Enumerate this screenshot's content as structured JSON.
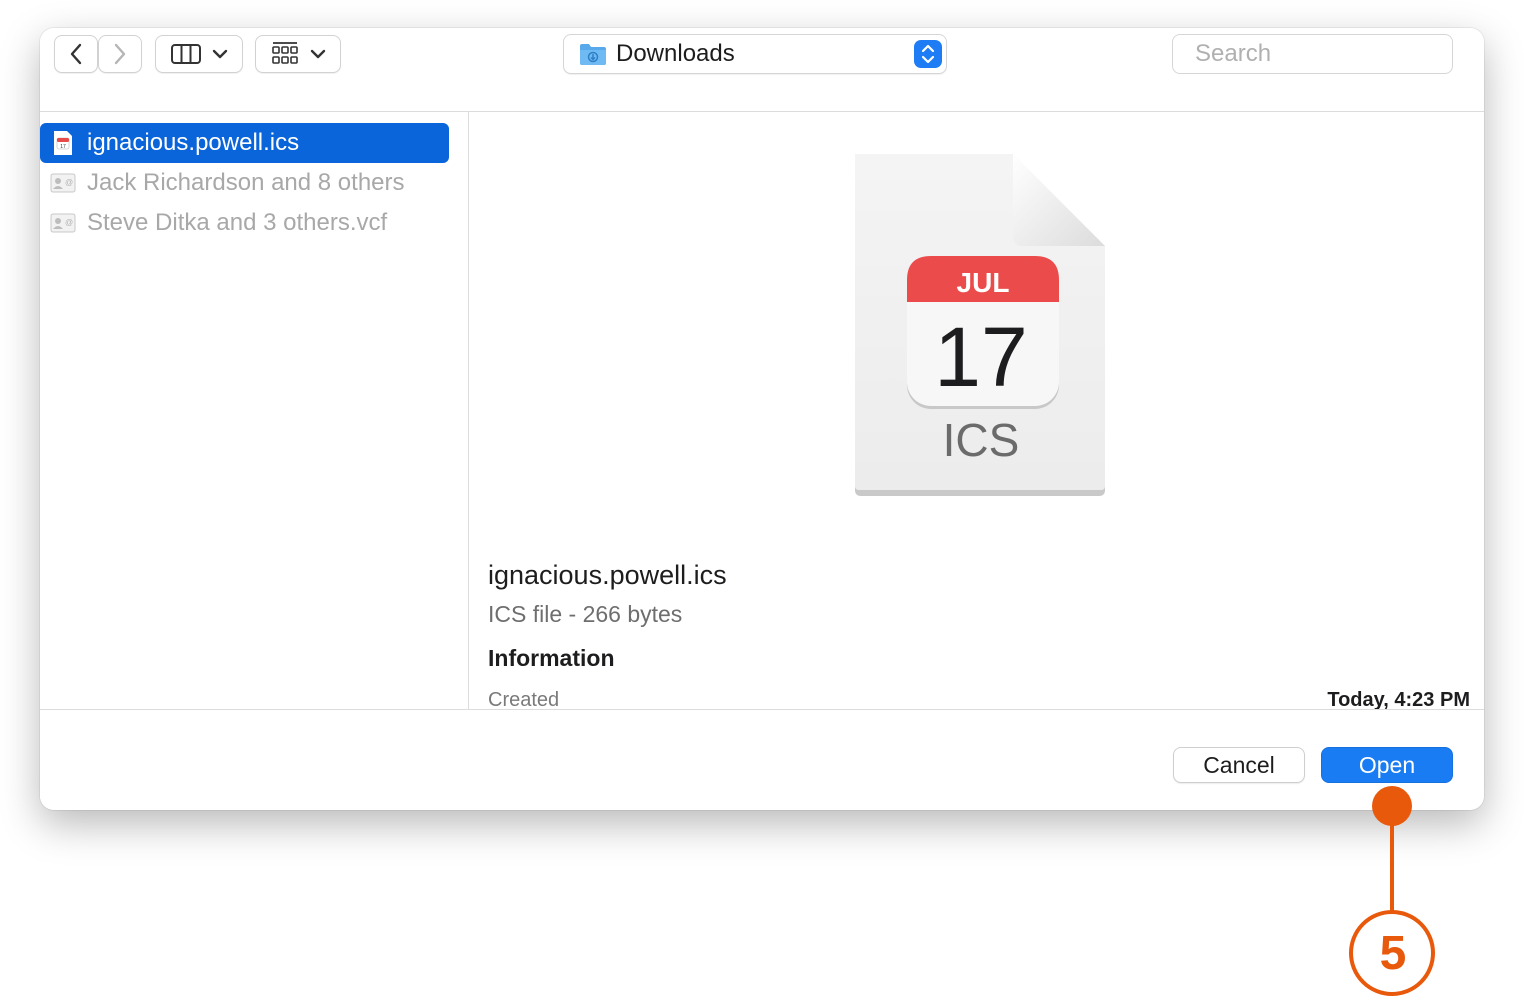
{
  "toolbar": {
    "back_icon": "chevron-left-icon",
    "forward_icon": "chevron-right-icon",
    "view_columns_icon": "columns-view-icon",
    "group_icon": "grid-group-icon",
    "location": "Downloads",
    "search_placeholder": "Search"
  },
  "sidebar": {
    "files": [
      {
        "name": "ignacious.powell.ics",
        "icon": "calendar-file-icon",
        "selected": true
      },
      {
        "name": "Jack Richardson and 8 others",
        "icon": "contact-card-icon",
        "selected": false
      },
      {
        "name": "Steve Ditka and 3 others.vcf",
        "icon": "contact-card-icon",
        "selected": false
      }
    ]
  },
  "preview": {
    "icon_month": "JUL",
    "icon_day": "17",
    "icon_ext": "ICS",
    "file_name": "ignacious.powell.ics",
    "file_desc": "ICS file - 266 bytes",
    "info_heading": "Information",
    "created_label": "Created",
    "created_value": "Today, 4:23 PM"
  },
  "footer": {
    "cancel_label": "Cancel",
    "open_label": "Open"
  },
  "annotation": {
    "step_number": "5",
    "color": "#e8590c"
  }
}
